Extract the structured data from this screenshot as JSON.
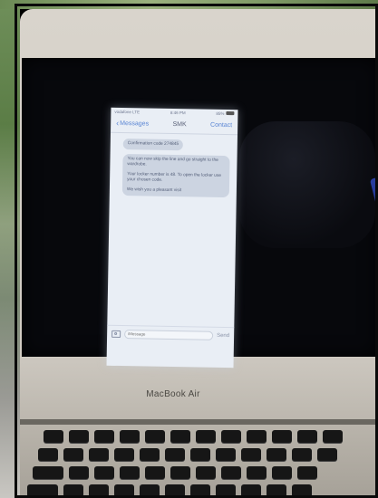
{
  "laptop": {
    "brand_label": "MacBook Air"
  },
  "phone": {
    "status": {
      "carrier": "vodafone LTE",
      "time": "8:46 PM",
      "battery": "85%"
    },
    "nav": {
      "back_label": "Messages",
      "title": "SMK",
      "contact_label": "Contact"
    },
    "messages": [
      {
        "text": "Confirmation code 274845"
      },
      {
        "paragraphs": [
          "You can now skip the line and go straight to the wardrobe.",
          "Your locker number is 48. To open the locker use your chosen code.",
          "We wish you a pleasant visit"
        ]
      }
    ],
    "input": {
      "placeholder": "iMessage",
      "send_label": "Send"
    }
  }
}
